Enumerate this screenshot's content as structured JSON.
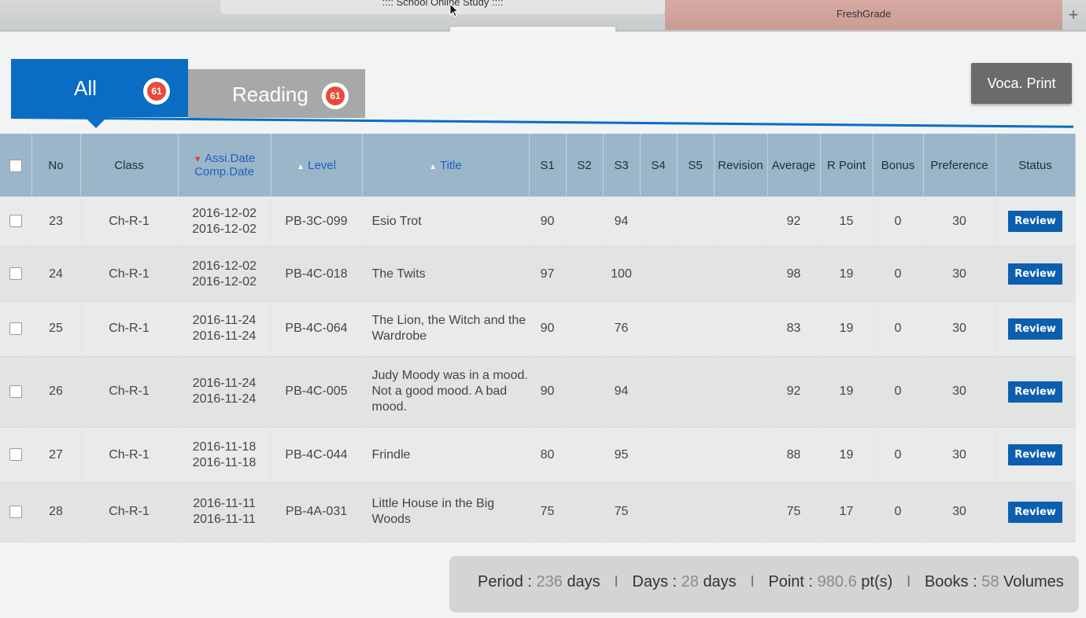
{
  "browser": {
    "active_tab": ":::: School Online Study ::::",
    "other_tab": "FreshGrade",
    "new_tab": "+",
    "tooltip": ":::: School Online Study ::::"
  },
  "tabs": [
    {
      "label": "All",
      "count": "61"
    },
    {
      "label": "Reading",
      "count": "61"
    }
  ],
  "voca_print": "Voca. Print",
  "table": {
    "headers": {
      "no": "No",
      "class": "Class",
      "assi_date": "Assi.Date",
      "comp_date": "Comp.Date",
      "level": "Level",
      "title": "Title",
      "s1": "S1",
      "s2": "S2",
      "s3": "S3",
      "s4": "S4",
      "s5": "S5",
      "revision": "Revision",
      "average": "Average",
      "rpoint": "R Point",
      "bonus": "Bonus",
      "preference": "Preference",
      "status": "Status"
    },
    "rows": [
      {
        "no": "23",
        "class": "Ch-R-1",
        "assi": "2016-12-02",
        "comp": "2016-12-02",
        "level": "PB-3C-099",
        "title": "Esio Trot",
        "s1": "90",
        "s2": "",
        "s3": "94",
        "s4": "",
        "s5": "",
        "revision": "",
        "average": "92",
        "rpoint": "15",
        "bonus": "0",
        "preference": "30",
        "status": "Review"
      },
      {
        "no": "24",
        "class": "Ch-R-1",
        "assi": "2016-12-02",
        "comp": "2016-12-02",
        "level": "PB-4C-018",
        "title": "The Twits",
        "s1": "97",
        "s2": "",
        "s3": "100",
        "s4": "",
        "s5": "",
        "revision": "",
        "average": "98",
        "rpoint": "19",
        "bonus": "0",
        "preference": "30",
        "status": "Review"
      },
      {
        "no": "25",
        "class": "Ch-R-1",
        "assi": "2016-11-24",
        "comp": "2016-11-24",
        "level": "PB-4C-064",
        "title": "The Lion, the Witch and the Wardrobe",
        "s1": "90",
        "s2": "",
        "s3": "76",
        "s4": "",
        "s5": "",
        "revision": "",
        "average": "83",
        "rpoint": "19",
        "bonus": "0",
        "preference": "30",
        "status": "Review"
      },
      {
        "no": "26",
        "class": "Ch-R-1",
        "assi": "2016-11-24",
        "comp": "2016-11-24",
        "level": "PB-4C-005",
        "title": "Judy Moody was in a mood. Not a good mood. A bad mood.",
        "s1": "90",
        "s2": "",
        "s3": "94",
        "s4": "",
        "s5": "",
        "revision": "",
        "average": "92",
        "rpoint": "19",
        "bonus": "0",
        "preference": "30",
        "status": "Review"
      },
      {
        "no": "27",
        "class": "Ch-R-1",
        "assi": "2016-11-18",
        "comp": "2016-11-18",
        "level": "PB-4C-044",
        "title": "Frindle",
        "s1": "80",
        "s2": "",
        "s3": "95",
        "s4": "",
        "s5": "",
        "revision": "",
        "average": "88",
        "rpoint": "19",
        "bonus": "0",
        "preference": "30",
        "status": "Review"
      },
      {
        "no": "28",
        "class": "Ch-R-1",
        "assi": "2016-11-11",
        "comp": "2016-11-11",
        "level": "PB-4A-031",
        "title": "Little House in the Big Woods",
        "s1": "75",
        "s2": "",
        "s3": "75",
        "s4": "",
        "s5": "",
        "revision": "",
        "average": "75",
        "rpoint": "17",
        "bonus": "0",
        "preference": "30",
        "status": "Review"
      }
    ]
  },
  "summary": {
    "period_label": "Period :",
    "period_value": "236",
    "period_unit": "days",
    "days_label": "Days :",
    "days_value": "28",
    "days_unit": "days",
    "point_label": "Point :",
    "point_value": "980.6",
    "point_unit": "pt(s)",
    "books_label": "Books :",
    "books_value": "58",
    "books_unit": "Volumes",
    "separator": "I"
  },
  "colors": {
    "tab_active": "#0a6dc4",
    "tab_inactive": "#a7a9a9",
    "header_bg": "#9bb6c9",
    "review_button": "#0b5fae",
    "badge": "#e84b3c"
  }
}
